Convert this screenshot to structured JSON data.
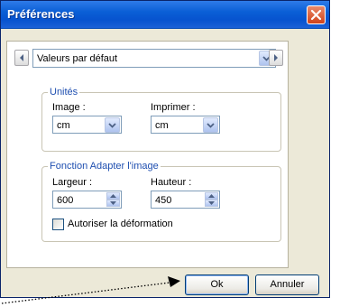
{
  "dialog": {
    "title": "Préférences"
  },
  "preset": {
    "selected": "Valeurs par défaut"
  },
  "units": {
    "legend": "Unités",
    "image_label": "Image :",
    "image_value": "cm",
    "print_label": "Imprimer :",
    "print_value": "cm"
  },
  "fit": {
    "legend": "Fonction Adapter l'image",
    "width_label": "Largeur :",
    "width_value": "600",
    "height_label": "Hauteur :",
    "height_value": "450",
    "distortion_label": "Autoriser la déformation",
    "distortion_checked": false
  },
  "buttons": {
    "ok": "Ok",
    "cancel": "Annuler"
  },
  "colors": {
    "titlebar": "#0753cf",
    "legend_text": "#1f4fb0",
    "window_bg": "#ece9d8",
    "close": "#d1431a"
  }
}
